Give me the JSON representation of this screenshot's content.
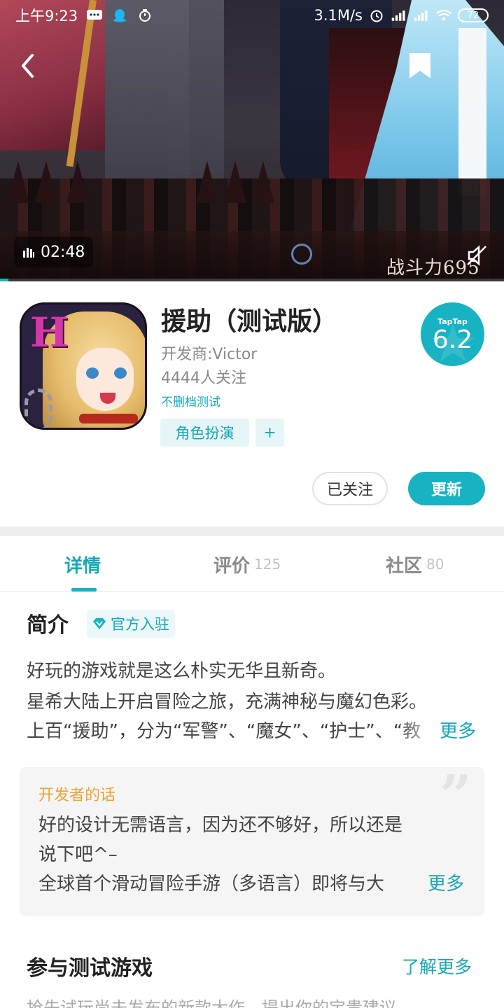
{
  "status_bar": {
    "time": "上午9:23",
    "network_speed": "3.1M/s",
    "battery": "72"
  },
  "video": {
    "duration": "02:48",
    "watermark": "战斗力695",
    "progress": 0.017
  },
  "app": {
    "title": "援助（测试版）",
    "developer": "开发商:Victor",
    "followers": "4444人关注",
    "test_label": "不删档测试",
    "tags": [
      "角色扮演",
      "+"
    ],
    "score_brand": "TapTap",
    "score": "6.2",
    "followed_label": "已关注",
    "update_label": "更新"
  },
  "tabs": [
    {
      "label": "详情",
      "count": "",
      "active": true
    },
    {
      "label": "评价",
      "count": "125",
      "active": false
    },
    {
      "label": "社区",
      "count": "80",
      "active": false
    }
  ],
  "intro": {
    "title": "简介",
    "official_badge": "官方入驻",
    "lines": [
      "好玩的游戏就是这么朴实无华且新奇。",
      "星希大陆上开启冒险之旅，充满神秘与魔幻色彩。",
      "上百“援助”，分为“军警”、“魔女”、“护士”、“教"
    ],
    "more": "更多"
  },
  "dev_note": {
    "label": "开发者的话",
    "lines": [
      "好的设计无需语言，因为还不够好，所以还是",
      "说下吧^–",
      "全球首个滑动冒险手游（多语言）即将与大"
    ],
    "more": "更多"
  },
  "join_test": {
    "title": "参与测试游戏",
    "learn_more": "了解更多",
    "desc": "抢先试玩尚未发布的新款大作，提出你的宝贵建议"
  },
  "colors": {
    "accent": "#16b5c4",
    "note_label": "#f0a236"
  }
}
